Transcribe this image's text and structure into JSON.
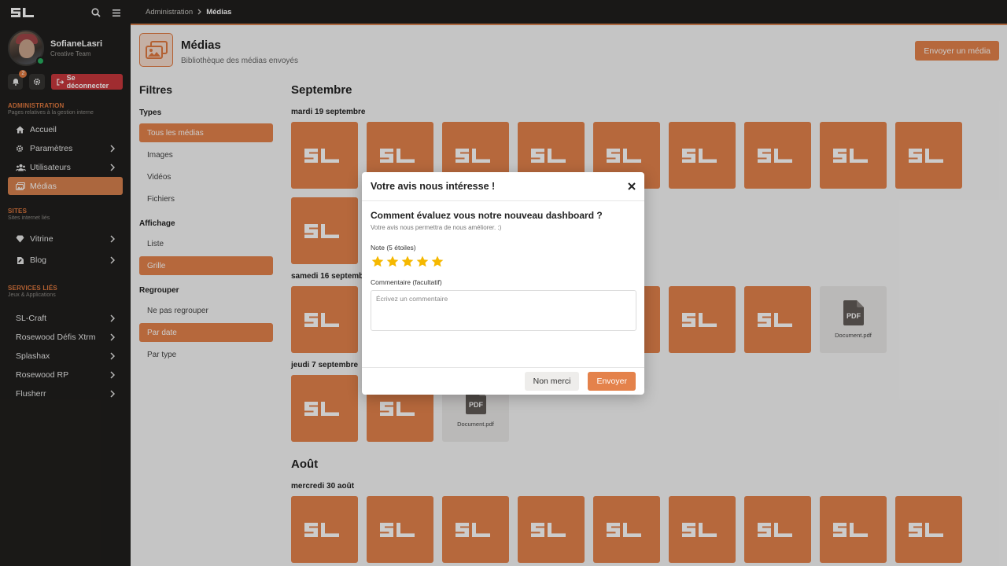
{
  "app": {
    "logo_text": "SL"
  },
  "sidebar": {
    "user": {
      "name": "SofianeLasri",
      "team": "Creative Team",
      "notifications": "2"
    },
    "logout_label": "Se déconnecter",
    "sections": [
      {
        "title": "Administration",
        "subtitle": "Pages relatives à la gestion interne",
        "items": [
          {
            "label": "Accueil",
            "icon": "home-icon",
            "chevron": false,
            "active": false
          },
          {
            "label": "Paramètres",
            "icon": "gear-icon",
            "chevron": true,
            "active": false
          },
          {
            "label": "Utilisateurs",
            "icon": "users-icon",
            "chevron": true,
            "active": false
          },
          {
            "label": "Médias",
            "icon": "images-icon",
            "chevron": false,
            "active": true
          }
        ]
      },
      {
        "title": "Sites",
        "subtitle": "Sites internet liés",
        "items": [
          {
            "label": "Vitrine",
            "icon": "gem-icon",
            "chevron": true
          },
          {
            "label": "Blog",
            "icon": "blog-icon",
            "chevron": true
          }
        ]
      },
      {
        "title": "Services liés",
        "subtitle": "Jeux & Applications",
        "items": [
          {
            "label": "SL-Craft",
            "chevron": true
          },
          {
            "label": "Rosewood Défis Xtrm",
            "chevron": true
          },
          {
            "label": "Splashax",
            "chevron": true
          },
          {
            "label": "Rosewood RP",
            "chevron": true
          },
          {
            "label": "Flusherr",
            "chevron": true
          }
        ]
      }
    ]
  },
  "breadcrumb": {
    "parent": "Administration",
    "current": "Médias"
  },
  "header": {
    "title": "Médias",
    "subtitle": "Bibliothèque des médias envoyés",
    "send_button": "Envoyer un média"
  },
  "filters": {
    "title": "Filtres",
    "groups": [
      {
        "title": "Types",
        "items": [
          {
            "label": "Tous les médias",
            "active": true
          },
          {
            "label": "Images",
            "active": false
          },
          {
            "label": "Vidéos",
            "active": false
          },
          {
            "label": "Fichiers",
            "active": false
          }
        ]
      },
      {
        "title": "Affichage",
        "items": [
          {
            "label": "Liste",
            "active": false
          },
          {
            "label": "Grille",
            "active": true
          }
        ]
      },
      {
        "title": "Regrouper",
        "items": [
          {
            "label": "Ne pas regrouper",
            "active": false
          },
          {
            "label": "Par date",
            "active": true
          },
          {
            "label": "Par type",
            "active": false
          }
        ]
      }
    ]
  },
  "gallery": {
    "months": [
      {
        "name": "Septembre",
        "days": [
          {
            "label": "mardi 19 septembre",
            "items": [
              "sl",
              "sl",
              "sl",
              "sl",
              "sl",
              "sl",
              "sl",
              "sl",
              "sl",
              "sl"
            ]
          },
          {
            "label": "samedi 16 septembre",
            "items": [
              "sl",
              "sl",
              "sl",
              "sl",
              "sl",
              "sl",
              "sl",
              "doc"
            ]
          },
          {
            "label": "jeudi 7 septembre",
            "items": [
              "sl",
              "sl",
              "doc"
            ]
          }
        ]
      },
      {
        "name": "Août",
        "days": [
          {
            "label": "mercredi 30 août",
            "items": [
              "sl",
              "sl",
              "sl",
              "sl",
              "sl",
              "sl",
              "sl",
              "sl",
              "sl"
            ]
          }
        ]
      }
    ],
    "doc_name": "Document.pdf",
    "doc_badge": "PDF"
  },
  "modal": {
    "title": "Votre avis nous intéresse !",
    "question": "Comment évaluez vous notre nouveau dashboard ?",
    "question_sub": "Votre avis nous permettra de nous améliorer. :)",
    "rating_label": "Note (5 étoiles)",
    "rating": 5,
    "comment_label": "Commentaire (facultatif)",
    "comment_placeholder": "Écrivez un commentaire",
    "cancel_label": "Non merci",
    "submit_label": "Envoyer"
  },
  "colors": {
    "accent": "#e4824b",
    "sidebar_bg": "#201f1d",
    "star": "#f5b800",
    "danger": "#c9383d"
  }
}
